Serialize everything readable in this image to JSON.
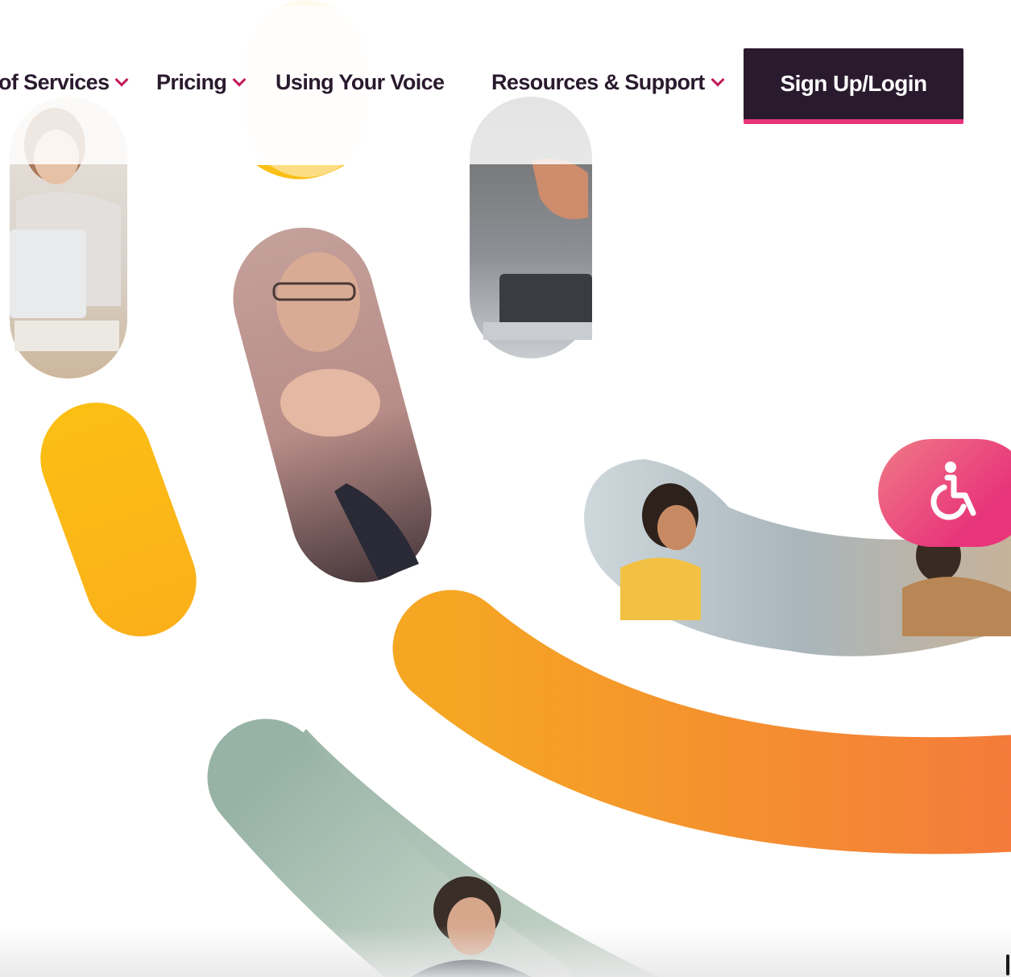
{
  "nav": {
    "items": [
      {
        "label": "of Services",
        "has_dropdown": true
      },
      {
        "label": "Pricing",
        "has_dropdown": true
      },
      {
        "label": "Using Your Voice",
        "has_dropdown": false
      },
      {
        "label": "Resources & Support",
        "has_dropdown": true
      }
    ],
    "signup_label": "Sign Up/Login"
  },
  "accessibility": {
    "icon": "wheelchair-icon"
  },
  "colors": {
    "ink": "#2a1a2e",
    "accent_pink": "#e8347a",
    "yellow": "#fbbf14",
    "orange": "#f5923a"
  }
}
